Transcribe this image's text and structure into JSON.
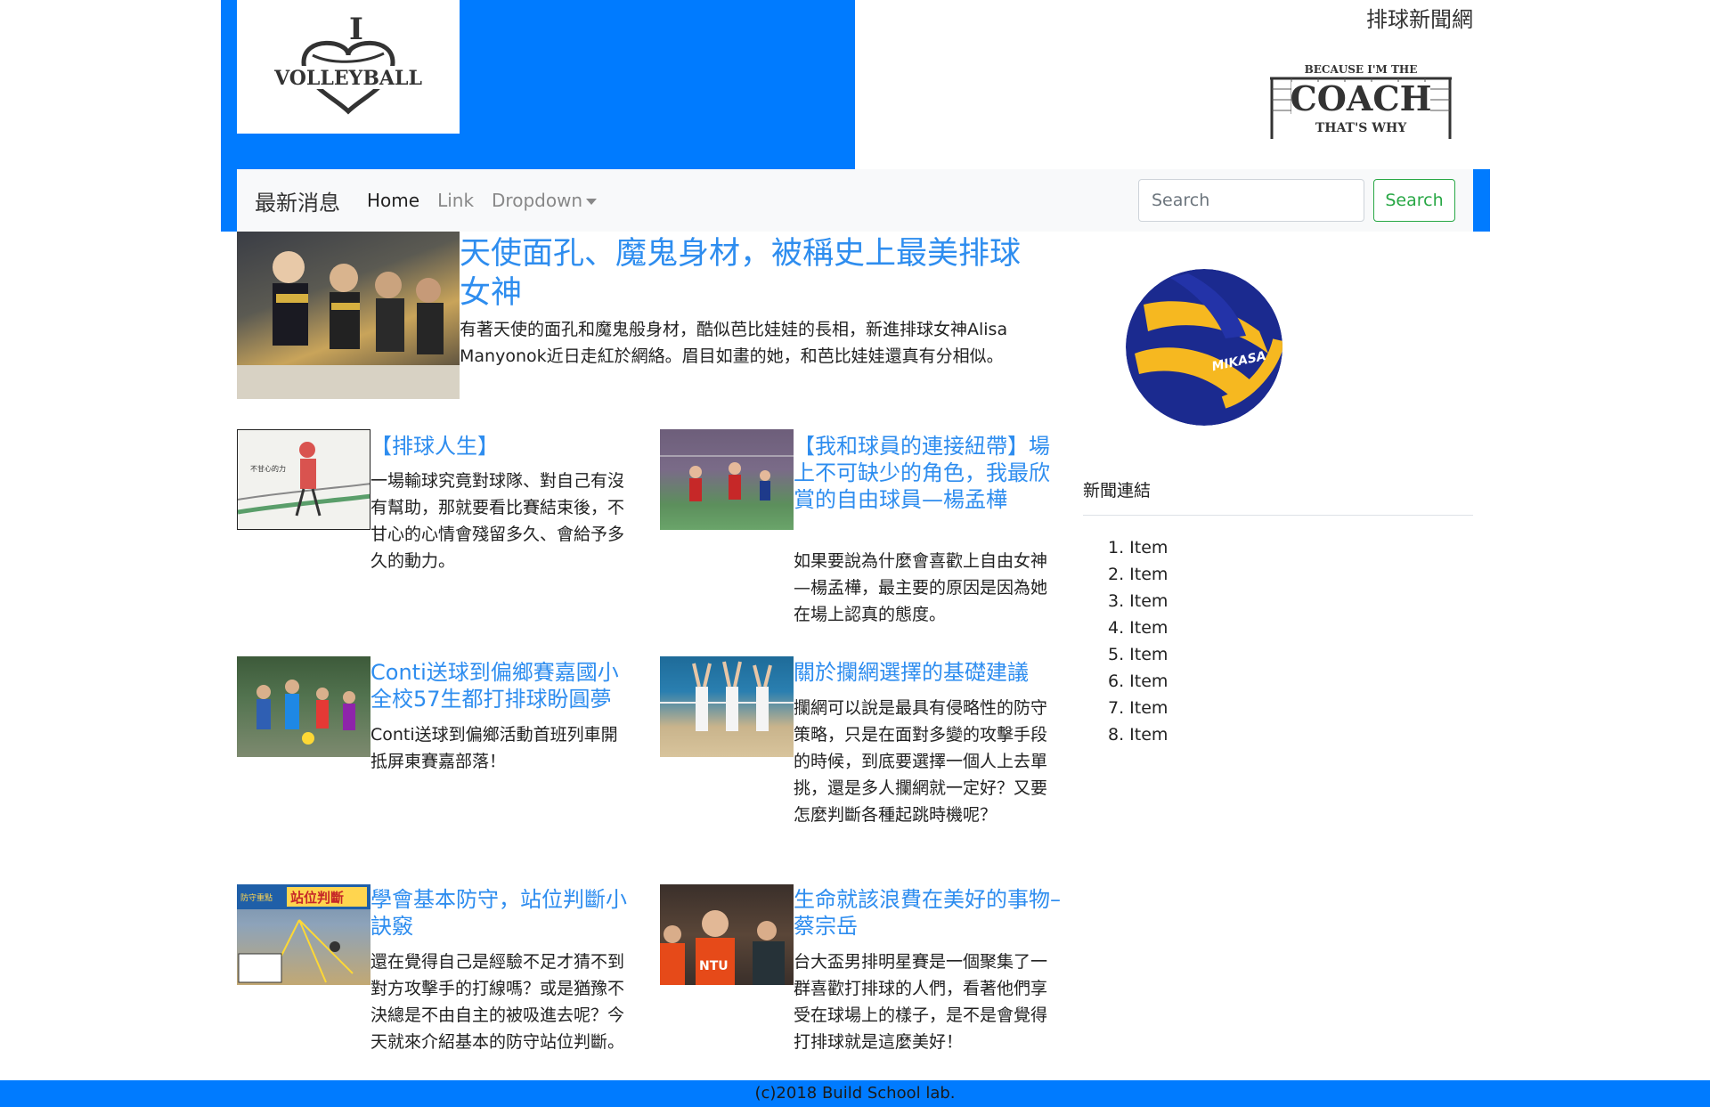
{
  "header": {
    "site_title": "排球新聞網",
    "logo_text_top": "I",
    "logo_text_main": "VOLLEYBALL",
    "coach_logo": {
      "line1": "BECAUSE I'M THE",
      "line2": "COACH",
      "line3": "THAT'S WHY"
    }
  },
  "navbar": {
    "brand": "最新消息",
    "links": [
      {
        "label": "Home"
      },
      {
        "label": "Link"
      },
      {
        "label": "Dropdown"
      }
    ],
    "search_placeholder": "Search",
    "search_button": "Search"
  },
  "featured": {
    "title": "天使面孔、魔鬼身材，被稱史上最美排球女神",
    "body": "有著天使的面孔和魔鬼般身材，酷似芭比娃娃的長相，新進排球女神Alisa Manyonok近日走紅於網絡。眉目如畫的她，和芭比娃娃還真有分相似。"
  },
  "articles": [
    {
      "title": "【排球人生】",
      "body": "一場輸球究竟對球隊、對自己有沒有幫助，那就要看比賽結束後，不甘心的心情會殘留多久、會給予多久的動力。",
      "image_caption": "不甘心的力"
    },
    {
      "title": "【我和球員的連接紐帶】場上不可缺少的角色，我最欣賞的自由球員—楊孟樺",
      "body": "如果要說為什麼會喜歡上自由女神—楊孟樺，最主要的原因是因為她在場上認真的態度。"
    },
    {
      "title": "Conti送球到偏鄉賽嘉國小全校57生都打排球盼圓夢",
      "body": "Conti送球到偏鄉活動首班列車開抵屏東賽嘉部落！"
    },
    {
      "title": "關於攔網選擇的基礎建議",
      "body": "攔網可以說是最具有侵略性的防守策略，只是在面對多變的攻擊手段的時候，到底要選擇一個人上去單挑，還是多人攔網就一定好？又要怎麼判斷各種起跳時機呢？"
    },
    {
      "title": "學會基本防守，站位判斷小訣竅",
      "body": "還在覺得自己是經驗不足才猜不到對方攻擊手的打線嗎？或是猶豫不決總是不由自主的被吸進去呢？今天就來介紹基本的防守站位判斷。",
      "image_caption_1": "防守重點",
      "image_caption_2": "站位判斷"
    },
    {
      "title": "生命就該浪費在美好的事物–蔡宗岳",
      "body": "台大盃男排明星賽是一個聚集了一群喜歡打排球的人們，看著他們享受在球場上的樣子，是不是會覺得打排球就是這麼美好！",
      "image_caption": "NTU"
    }
  ],
  "sidebar": {
    "ball_brand": "MIKASA",
    "links_title": "新聞連結",
    "items": [
      "1. Item",
      "2. Item",
      "3. Item",
      "4. Item",
      "5. Item",
      "6. Item",
      "7. Item",
      "8. Item"
    ]
  },
  "footer": {
    "text": "(c)2018 Build School lab."
  },
  "colors": {
    "primary": "#007bff",
    "title_link": "#2e8def",
    "success": "#28a745",
    "navbar_bg": "#f8f9fa"
  }
}
